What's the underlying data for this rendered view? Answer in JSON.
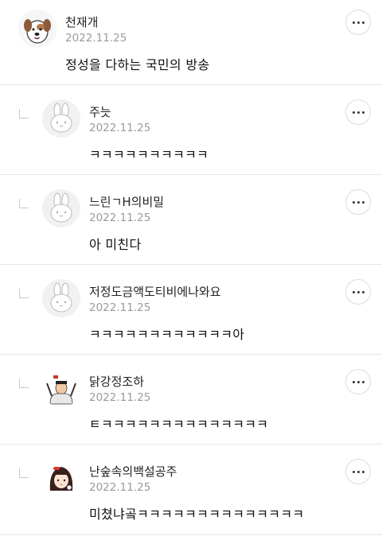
{
  "comments": [
    {
      "name": "천재개",
      "date": "2022.11.25",
      "text": "정성을 다하는 국민의 방송",
      "avatar": "dog-avatar-icon",
      "reply": false
    },
    {
      "name": "주늣",
      "date": "2022.11.25",
      "text": "ㅋㅋㅋㅋㅋㅋㅋㅋㅋㅋ",
      "avatar": "bunny-avatar-icon",
      "reply": true
    },
    {
      "name": "느린ㄱH의비밀",
      "date": "2022.11.25",
      "text": "아 미친다",
      "avatar": "bunny-avatar-icon",
      "reply": true
    },
    {
      "name": "저정도금액도티비에나와요",
      "date": "2022.11.25",
      "text": "ㅋㅋㅋㅋㅋㅋㅋㅋㅋㅋㅋㅋ아",
      "avatar": "bunny-avatar-icon",
      "reply": true
    },
    {
      "name": "닭강정조하",
      "date": "2022.11.25",
      "text": "ㅌㅋㅋㅋㅋㅋㅋㅋㅋㅋㅋㅋㅋㅋㅋ",
      "avatar": "person-avatar-icon",
      "reply": true
    },
    {
      "name": "난숲속의백설공주",
      "date": "2022.11.25",
      "text": "미쳤냐곸ㅋㅋㅋㅋㅋㅋㅋㅋㅋㅋㅋㅋㅋㅋ",
      "avatar": "girl-avatar-icon",
      "reply": true
    }
  ],
  "more_icon": "more-horizontal-icon",
  "reply_icon": "reply-indent-icon"
}
